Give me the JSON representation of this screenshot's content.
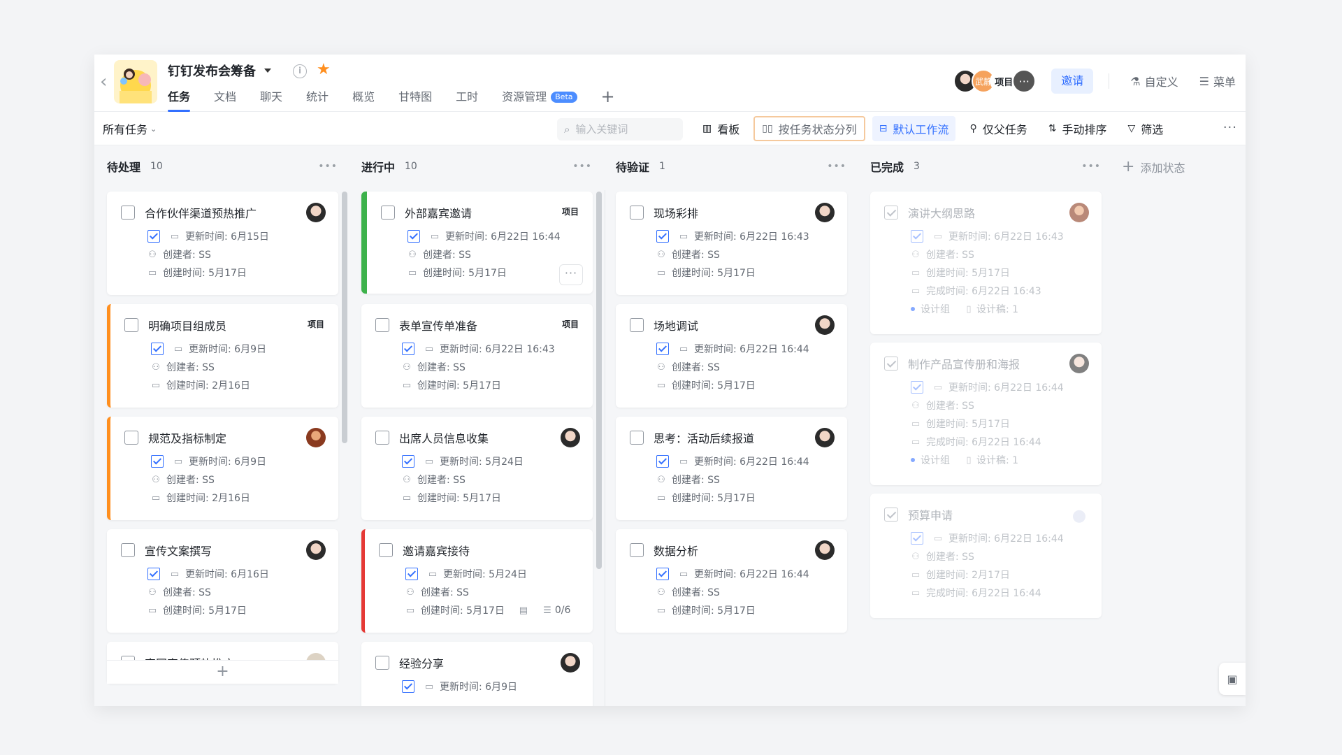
{
  "header": {
    "project_title": "钉钉发布会筹备",
    "tabs": [
      {
        "label": "任务"
      },
      {
        "label": "文档"
      },
      {
        "label": "聊天"
      },
      {
        "label": "统计"
      },
      {
        "label": "概览"
      },
      {
        "label": "甘特图"
      },
      {
        "label": "工时"
      },
      {
        "label": "资源管理",
        "badge": "Beta"
      }
    ],
    "add_tab": "+",
    "members": [
      "",
      "武静",
      "项目",
      "···"
    ],
    "invite_label": "邀请",
    "customize_label": "自定义",
    "menu_label": "菜单"
  },
  "toolbar": {
    "all_tasks_label": "所有任务",
    "search_placeholder": "输入关键词",
    "board_label": "看板",
    "group_label": "按任务状态分列",
    "workflow_label": "默认工作流",
    "parent_only_label": "仅父任务",
    "sort_label": "手动排序",
    "filter_label": "筛选",
    "more": "···"
  },
  "columns": [
    {
      "name": "待处理",
      "count": "10",
      "cards": [
        {
          "title": "合作伙伴渠道预热推广",
          "updated": "更新时间: 6月15日",
          "creator": "创建者: SS",
          "created": "创建时间: 5月17日"
        },
        {
          "title": "明确项目组成员",
          "tag": "项目",
          "updated": "更新时间: 6月9日",
          "creator": "创建者: SS",
          "created": "创建时间: 2月16日"
        },
        {
          "title": "规范及指标制定",
          "updated": "更新时间: 6月9日",
          "creator": "创建者: SS",
          "created": "创建时间: 2月16日"
        },
        {
          "title": "宣传文案撰写",
          "updated": "更新时间: 6月16日",
          "creator": "创建者: SS",
          "created": "创建时间: 5月17日"
        },
        {
          "title": "官网宣传预热推广"
        }
      ]
    },
    {
      "name": "进行中",
      "count": "10",
      "cards": [
        {
          "title": "外部嘉宾邀请",
          "tag": "项目",
          "updated": "更新时间: 6月22日 16:44",
          "creator": "创建者: SS",
          "created": "创建时间: 5月17日"
        },
        {
          "title": "表单宣传单准备",
          "tag": "项目",
          "updated": "更新时间: 6月22日 16:43",
          "creator": "创建者: SS",
          "created": "创建时间: 5月17日"
        },
        {
          "title": "出席人员信息收集",
          "updated": "更新时间: 5月24日",
          "creator": "创建者: SS",
          "created": "创建时间: 5月17日"
        },
        {
          "title": "邀请嘉宾接待",
          "updated": "更新时间: 5月24日",
          "creator": "创建者: SS",
          "created": "创建时间: 5月17日",
          "subtasks": "0/6"
        },
        {
          "title": "经验分享",
          "updated": "更新时间: 6月9日"
        }
      ]
    },
    {
      "name": "待验证",
      "count": "1",
      "cards": [
        {
          "title": "现场彩排",
          "updated": "更新时间: 6月22日 16:43",
          "creator": "创建者: SS",
          "created": "创建时间: 5月17日"
        },
        {
          "title": "场地调试",
          "updated": "更新时间: 6月22日 16:44",
          "creator": "创建者: SS",
          "created": "创建时间: 5月17日"
        },
        {
          "title": "思考：活动后续报道",
          "updated": "更新时间: 6月22日 16:44",
          "creator": "创建者: SS",
          "created": "创建时间: 5月17日"
        },
        {
          "title": "数据分析",
          "updated": "更新时间: 6月22日 16:44",
          "creator": "创建者: SS",
          "created": "创建时间: 5月17日"
        }
      ]
    },
    {
      "name": "已完成",
      "count": "3",
      "cards": [
        {
          "title": "演讲大纲思路",
          "updated": "更新时间: 6月22日 16:43",
          "creator": "创建者: SS",
          "created": "创建时间: 5月17日",
          "completed": "完成时间: 6月22日 16:43",
          "group": "设计组",
          "draft": "设计稿: 1"
        },
        {
          "title": "制作产品宣传册和海报",
          "updated": "更新时间: 6月22日 16:44",
          "creator": "创建者: SS",
          "created": "创建时间: 5月17日",
          "completed": "完成时间: 6月22日 16:44",
          "group": "设计组",
          "draft": "设计稿: 1"
        },
        {
          "title": "预算申请",
          "updated": "更新时间: 6月22日 16:44",
          "creator": "创建者: SS",
          "created": "创建时间: 2月17日",
          "completed": "完成时间: 6月22日 16:44"
        }
      ]
    }
  ],
  "add_status_label": "添加状态",
  "add_card_label": "+",
  "colors": {
    "accent": "#3370ff",
    "orange": "#ff8f1f",
    "green": "#3db24b",
    "red": "#e53935"
  }
}
